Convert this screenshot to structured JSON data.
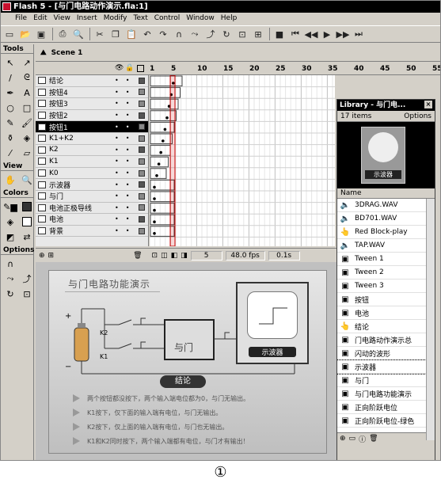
{
  "window": {
    "title": "Flash 5 - [与门电路动作演示.fla:1]"
  },
  "menu": [
    "File",
    "Edit",
    "View",
    "Insert",
    "Modify",
    "Text",
    "Control",
    "Window",
    "Help"
  ],
  "tools": {
    "title": "Tools",
    "view": "View",
    "colors": "Colors",
    "options": "Options"
  },
  "scene": {
    "label": "Scene 1"
  },
  "timeline": {
    "frame_numbers": [
      "1",
      "5",
      "10",
      "15",
      "20",
      "25",
      "30",
      "35",
      "40",
      "45",
      "50",
      "55"
    ],
    "layers": [
      "结论",
      "按钮4",
      "按钮3",
      "按钮2",
      "按钮1",
      "K1+K2",
      "K2",
      "K1",
      "K0",
      "示波器",
      "与门",
      "电池正极导线",
      "电池",
      "背景"
    ],
    "selected_layer": "按钮1",
    "current_frame": "5",
    "fps": "48.0 fps",
    "time": "0.1s"
  },
  "library": {
    "title": "Library - 与门电...",
    "count": "17 items",
    "options": "Options",
    "preview_label": "示波器",
    "column": "Name",
    "items": [
      {
        "name": "3DRAG.WAV",
        "icon": "sound-icon"
      },
      {
        "name": "BD701.WAV",
        "icon": "sound-icon"
      },
      {
        "name": "Red Block-play",
        "icon": "button-icon"
      },
      {
        "name": "TAP.WAV",
        "icon": "sound-icon"
      },
      {
        "name": "Tween 1",
        "icon": "graphic-icon"
      },
      {
        "name": "Tween 2",
        "icon": "graphic-icon"
      },
      {
        "name": "Tween 3",
        "icon": "graphic-icon"
      },
      {
        "name": "按钮",
        "icon": "graphic-icon"
      },
      {
        "name": "电池",
        "icon": "graphic-icon"
      },
      {
        "name": "结论",
        "icon": "button-icon"
      },
      {
        "name": "门电路动作演示总",
        "icon": "graphic-icon"
      },
      {
        "name": "闪动的波形",
        "icon": "graphic-icon"
      },
      {
        "name": "示波器",
        "icon": "graphic-icon"
      },
      {
        "name": "与门",
        "icon": "graphic-icon"
      },
      {
        "name": "与门电路功能演示",
        "icon": "graphic-icon"
      },
      {
        "name": "正向阶跃电位",
        "icon": "graphic-icon"
      },
      {
        "name": "正向阶跃电位-绿色",
        "icon": "graphic-icon"
      }
    ]
  },
  "stage": {
    "heading": "与门电路功能演示",
    "gate_label": "与门",
    "scope_label": "示波器",
    "k2": "K2",
    "k1": "K1",
    "plus": "+",
    "minus": "−",
    "button_label": "结论",
    "lines": [
      "两个按钮都没按下，两个输入端电位都为0，与门无输出。",
      "K1按下，仅下面的输入端有电位，与门无输出。",
      "K2按下，仅上面的输入端有电位，与门也无输出。",
      "K1和K2同时按下，两个输入端都有电位，与门才有输出！"
    ]
  },
  "caption": "①"
}
